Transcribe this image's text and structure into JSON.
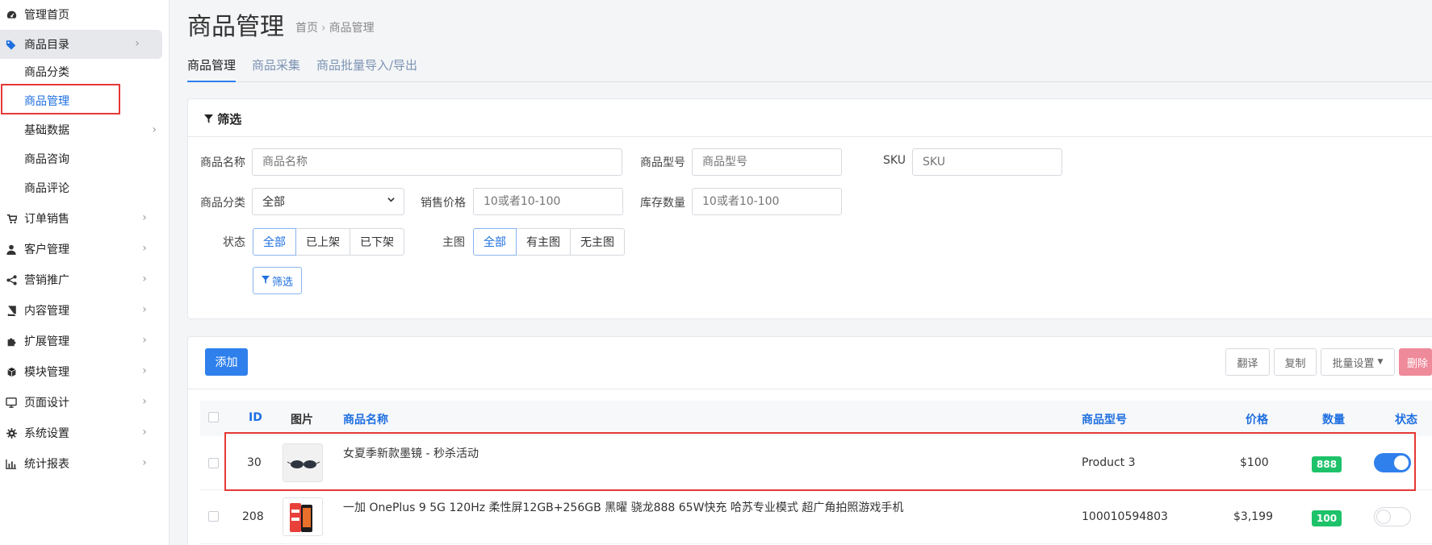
{
  "sidebar": {
    "items": [
      {
        "label": "管理首页",
        "icon": "dashboard-icon"
      },
      {
        "label": "商品目录",
        "icon": "tags-icon"
      },
      {
        "label": "订单销售",
        "icon": "cart-icon"
      },
      {
        "label": "客户管理",
        "icon": "user-icon"
      },
      {
        "label": "营销推广",
        "icon": "share-icon"
      },
      {
        "label": "内容管理",
        "icon": "book-icon"
      },
      {
        "label": "扩展管理",
        "icon": "puzzle-icon"
      },
      {
        "label": "模块管理",
        "icon": "cube-icon"
      },
      {
        "label": "页面设计",
        "icon": "desktop-icon"
      },
      {
        "label": "系统设置",
        "icon": "gear-icon"
      },
      {
        "label": "统计报表",
        "icon": "bar-chart-icon"
      }
    ],
    "subitems": [
      {
        "label": "商品分类"
      },
      {
        "label": "商品管理"
      },
      {
        "label": "基础数据"
      },
      {
        "label": "商品咨询"
      },
      {
        "label": "商品评论"
      }
    ]
  },
  "header": {
    "title": "商品管理",
    "breadcrumb": [
      "首页",
      "商品管理"
    ]
  },
  "tabs": [
    {
      "label": "商品管理"
    },
    {
      "label": "商品采集"
    },
    {
      "label": "商品批量导入/导出"
    }
  ],
  "filter": {
    "title": "筛选",
    "name_label": "商品名称",
    "name_placeholder": "商品名称",
    "model_label": "商品型号",
    "model_placeholder": "商品型号",
    "sku_label": "SKU",
    "sku_placeholder": "SKU",
    "category_label": "商品分类",
    "category_value": "全部",
    "price_label": "销售价格",
    "price_placeholder": "10或者10-100",
    "stock_label": "库存数量",
    "stock_placeholder": "10或者10-100",
    "status_label": "状态",
    "status_options": [
      "全部",
      "已上架",
      "已下架"
    ],
    "image_label": "主图",
    "image_options": [
      "全部",
      "有主图",
      "无主图"
    ],
    "submit_label": "筛选"
  },
  "toolbar": {
    "add_label": "添加",
    "translate_label": "翻译",
    "copy_label": "复制",
    "batch_label": "批量设置",
    "delete_label": "删除"
  },
  "table": {
    "headers": {
      "id": "ID",
      "image": "图片",
      "name": "商品名称",
      "model": "商品型号",
      "price": "价格",
      "qty": "数量",
      "status": "状态"
    },
    "rows": [
      {
        "id": "30",
        "name": "女夏季新款墨镜 - 秒杀活动",
        "model": "Product 3",
        "price": "$100",
        "qty": "888",
        "enabled": true
      },
      {
        "id": "208",
        "name": "一加 OnePlus 9 5G 120Hz 柔性屏12GB+256GB 黑曜 骁龙888 65W快充 哈苏专业模式 超广角拍照游戏手机",
        "model": "100010594803",
        "price": "$3,199",
        "qty": "100",
        "enabled": false
      }
    ]
  },
  "colors": {
    "accent": "#2f80ed",
    "highlight": "#e53935",
    "success": "#1ec26a",
    "danger": "#ef8a9b"
  }
}
